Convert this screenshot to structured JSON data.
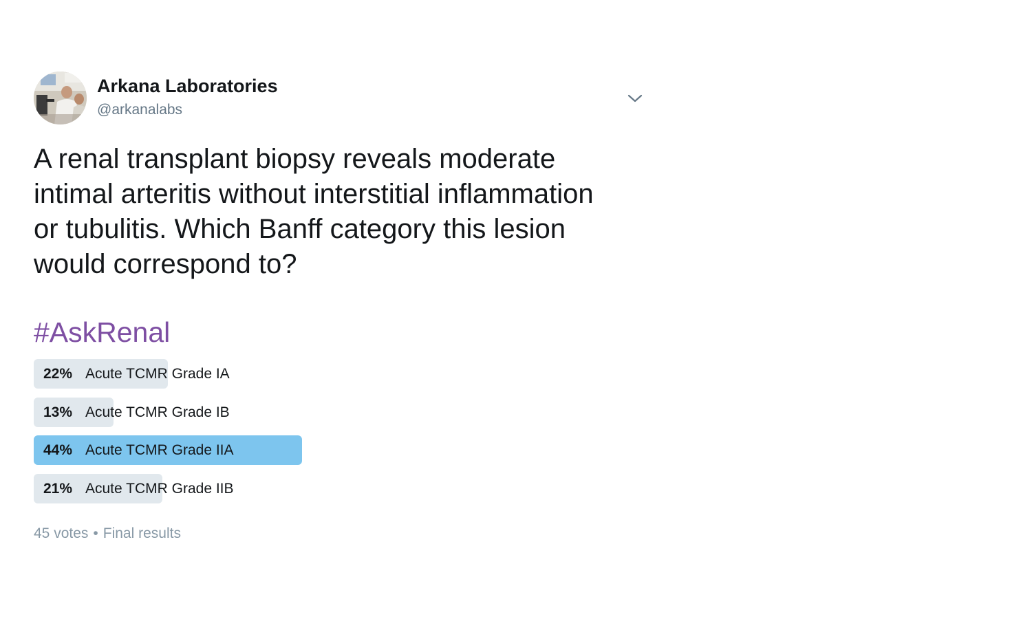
{
  "author": {
    "name": "Arkana Laboratories",
    "handle": "@arkanalabs",
    "avatar_icon": "profile-photo",
    "menu_icon": "chevron-down-icon"
  },
  "tweet": {
    "text": "A renal transplant biopsy reveals moderate intimal arteritis without interstitial inflammation or tubulitis. Which Banff category this lesion would correspond to?",
    "hashtag": "#AskRenal"
  },
  "poll": {
    "options": [
      {
        "percent_label": "22%",
        "percent": 22,
        "label": "Acute TCMR Grade IA",
        "winner": false
      },
      {
        "percent_label": "13%",
        "percent": 13,
        "label": "Acute TCMR Grade IB",
        "winner": false
      },
      {
        "percent_label": "44%",
        "percent": 44,
        "label": "Acute TCMR Grade IIA",
        "winner": true
      },
      {
        "percent_label": "21%",
        "percent": 21,
        "label": "Acute TCMR Grade IIB",
        "winner": false
      }
    ],
    "votes": "45 votes",
    "separator": "•",
    "status": "Final results"
  },
  "colors": {
    "hashtag": "#7e4fa3",
    "bar": "#e1e8ed",
    "winner_bar": "#7dc5ee",
    "muted_text": "#657786"
  }
}
